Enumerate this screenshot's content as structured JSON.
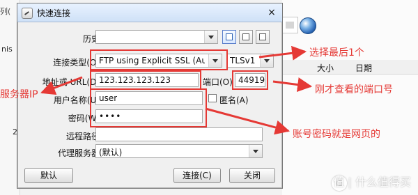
{
  "background": {
    "left_top": "列(",
    "left_text": "nis",
    "left_number": "2",
    "right_header": {
      "size": "大小",
      "date": "日期"
    }
  },
  "dialog": {
    "title": "快速连接",
    "history_label": "历史",
    "history_value": "",
    "connection_type_label": "连接类型(O)",
    "connection_type_value": "FTP using Explicit SSL (Auth TLS",
    "tls_value": "TLSv1",
    "address_label": "地址或 URL(D)",
    "address_value": "123.123.123.123",
    "port_label": "端口(O)",
    "port_value": "44919",
    "username_label": "用户名称(U)",
    "username_value": "user",
    "anonymous_label": "匿名(A)",
    "password_label": "密码(W)",
    "password_value": "••••",
    "remote_path_label": "远程路径",
    "remote_path_value": "",
    "proxy_label": "代理服务器",
    "proxy_value": "(默认)",
    "btn_default": "默认",
    "btn_connect": "连接(C)",
    "btn_close": "关闭"
  },
  "annotations": {
    "select_last": "选择最后1个",
    "port_note": "刚才查看的端口号",
    "server_ip": "服务器IP",
    "account_note": "账号密码就是网页的"
  },
  "watermark": "值 | 什么值得买",
  "colors": {
    "annotation_red": "#e53935"
  }
}
